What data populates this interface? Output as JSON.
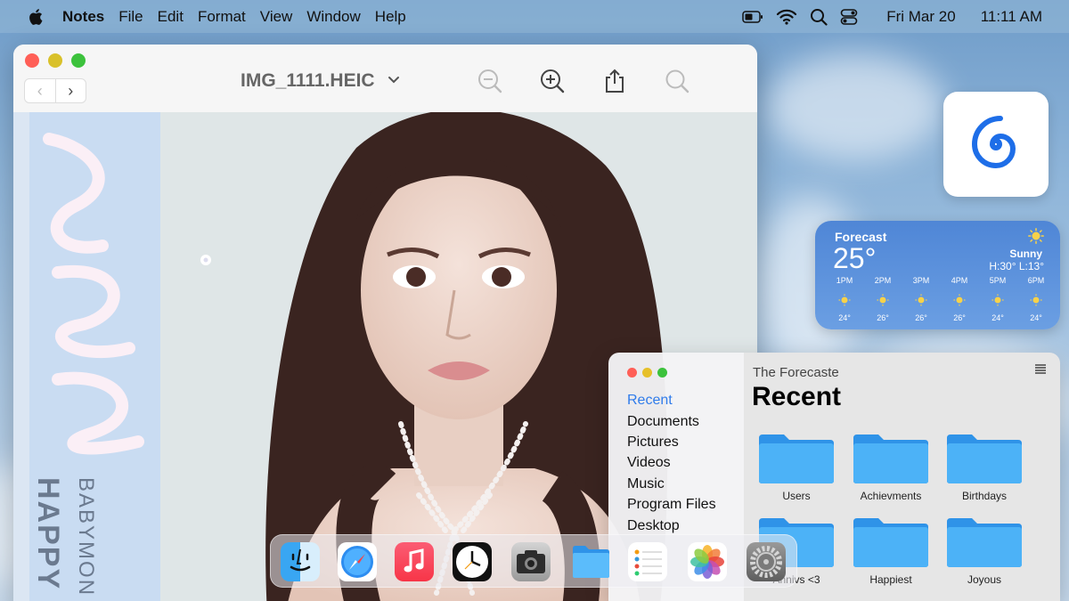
{
  "menubar": {
    "app_name": "Notes",
    "menus": [
      "File",
      "Edit",
      "Format",
      "View",
      "Window",
      "Help"
    ],
    "date": "Fri Mar 20",
    "time": "11:11 AM"
  },
  "preview": {
    "filename": "IMG_1111.HEIC",
    "album_text_1": "HAPPY",
    "album_text_2": "BABYMON"
  },
  "weather": {
    "title": "Forecast",
    "temp": "25°",
    "condition": "Sunny",
    "high_low": "H:30° L:13°",
    "hours": [
      {
        "time": "1PM",
        "temp": "24°"
      },
      {
        "time": "2PM",
        "temp": "26°"
      },
      {
        "time": "3PM",
        "temp": "26°"
      },
      {
        "time": "4PM",
        "temp": "26°"
      },
      {
        "time": "5PM",
        "temp": "24°"
      },
      {
        "time": "6PM",
        "temp": "24°"
      }
    ]
  },
  "finder": {
    "subtitle": "The Forecaste",
    "heading": "Recent",
    "sidebar": [
      "Recent",
      "Documents",
      "Pictures",
      "Videos",
      "Music",
      "Program Files",
      "Desktop"
    ],
    "folders": [
      "Users",
      "Achievments",
      "Birthdays",
      "Annivs <3",
      "Happiest",
      "Joyous"
    ]
  },
  "dock": {
    "apps": [
      "finder-icon",
      "safari-icon",
      "music-icon",
      "clock-icon",
      "camera-icon",
      "folder-icon",
      "reminders-icon",
      "photos-icon",
      "settings-icon"
    ]
  },
  "colors": {
    "accent": "#2f7bea",
    "folder": "#4aaef5",
    "weather": "#5a90dc"
  }
}
